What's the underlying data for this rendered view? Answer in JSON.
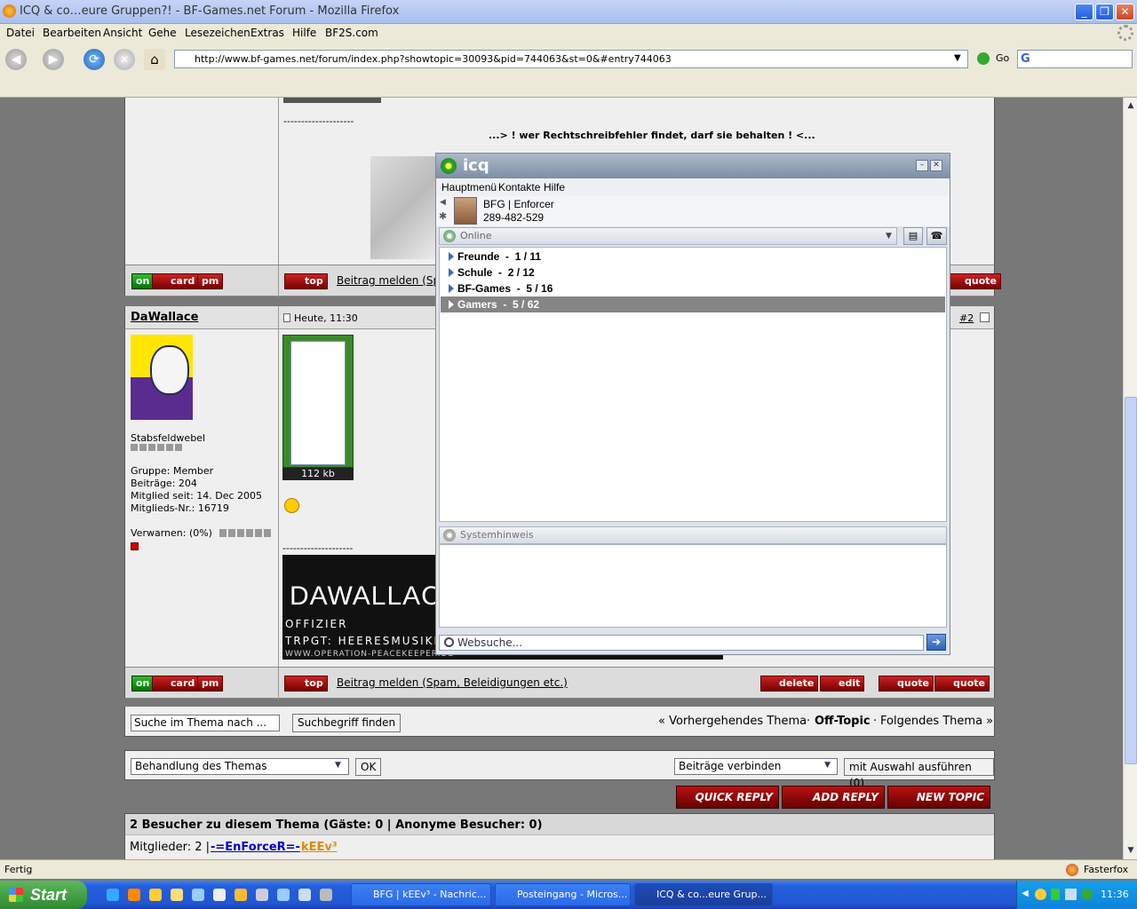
{
  "window": {
    "title": "ICQ & co…eure Gruppen?! - BF-Games.net Forum - Mozilla Firefox"
  },
  "menubar": {
    "items": [
      "Datei",
      "Bearbeiten",
      "Ansicht",
      "Gehe",
      "Lesezeichen",
      "Extras",
      "Hilfe",
      "BF2S.com"
    ]
  },
  "nav": {
    "url": "http://www.bf-games.net/forum/index.php?showtopic=30093&pid=744063&st=0&#entry744063",
    "go_label": "Go"
  },
  "post1": {
    "sig_dashes": "--------------------",
    "sig_text": "...> ! wer Rechtschreibfehler findet, darf sie behalten ! <...",
    "btn_on": "on",
    "btn_card": "card",
    "btn_pm": "pm",
    "btn_top": "top",
    "report_link": "Beitrag melden (Sp",
    "btn_quote": "quote"
  },
  "post2": {
    "author": "DaWallace",
    "time": "Heute, 11:30",
    "post_no": "#2",
    "rank": "Stabsfeldwebel",
    "group": "Gruppe: Member",
    "posts": "Beiträge: 204",
    "member_since": "Mitglied seit: 14. Dec 2005",
    "member_no": "Mitglieds-Nr.: 16719",
    "warn": "Verwarnen: (0%)",
    "attachment_size": "112 kb",
    "sig_dashes": "--------------------",
    "banner_name": "DaWallace",
    "banner_line1": "Offizier",
    "banner_line2": "Trpgt: Heeresmusikk",
    "banner_line3": "www.operation-peacekeeper.de",
    "btn_on": "on",
    "btn_card": "card",
    "btn_pm": "pm",
    "btn_top": "top",
    "report_link": "Beitrag melden (Spam, Beleidigungen etc.)",
    "btn_delete": "delete",
    "btn_edit": "edit",
    "btn_addquote": "quote",
    "btn_quote": "quote"
  },
  "search": {
    "input": "Suche im Thema nach ...",
    "button": "Suchbegriff finden"
  },
  "topicnav": {
    "prev": "« Vorhergehendes Thema",
    "sep": "·",
    "forum": "Off-Topic",
    "next": "Folgendes Thema »"
  },
  "moderation": {
    "select1": "Behandlung des Themas",
    "ok": "OK",
    "select2": "Beiträge verbinden",
    "run": "mit Auswahl ausführen (0)"
  },
  "actions": {
    "quick_reply": "Quick Reply",
    "add_reply": "Add Reply",
    "new_topic": "New Topic"
  },
  "visitors": {
    "header": "2 Besucher zu diesem Thema (Gäste: 0 | Anonyme Besucher: 0)",
    "members_label": "Mitglieder: 2 |",
    "member1": "-=EnForceR=-",
    "member2": "kEEv³"
  },
  "icq": {
    "title": "icq",
    "menu": [
      "Hauptmenü",
      "Kontakte",
      "Hilfe"
    ],
    "user_name": "BFG | Enforcer",
    "user_uin": "289-482-529",
    "status": "Online",
    "groups": [
      {
        "name": "Freunde",
        "count": "1 / 11"
      },
      {
        "name": "Schule",
        "count": "2 / 12"
      },
      {
        "name": "BF-Games",
        "count": "5 / 16"
      },
      {
        "name": "Gamers",
        "count": "5 / 62"
      }
    ],
    "system_label": "Systemhinweis",
    "search_placeholder": "Websuche..."
  },
  "statusbar": {
    "left": "Fertig",
    "right": "Fasterfox"
  },
  "taskbar": {
    "start": "Start",
    "tasks": [
      "BFG | kEEv³ - Nachric...",
      "Posteingang - Micros...",
      "ICQ & co...eure Grup..."
    ],
    "clock": "11:36"
  },
  "colors": {
    "accent_red": "#aa1111",
    "icq_selected": "#858585",
    "link_blue": "#0000cc",
    "member_orange": "#e08a00"
  }
}
